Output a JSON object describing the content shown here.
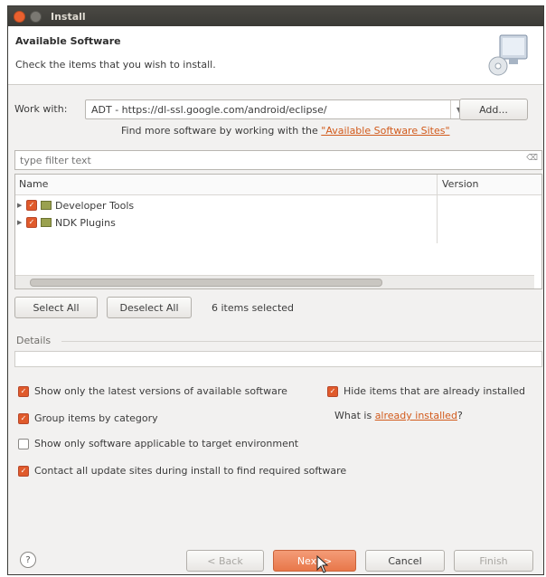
{
  "window": {
    "title": "Install"
  },
  "header": {
    "title": "Available Software",
    "description": "Check the items that you wish to install."
  },
  "work_with": {
    "label": "Work with:",
    "value": "ADT - https://dl-ssl.google.com/android/eclipse/",
    "add_button": "Add..."
  },
  "find_more": {
    "text": "Find more software by working with the ",
    "link": "\"Available Software Sites\""
  },
  "filter": {
    "placeholder": "type filter text"
  },
  "tree": {
    "columns": [
      "Name",
      "Version"
    ],
    "items": [
      {
        "label": "Developer Tools",
        "checked": true
      },
      {
        "label": "NDK Plugins",
        "checked": true
      }
    ]
  },
  "selection": {
    "select_all": "Select All",
    "deselect_all": "Deselect All",
    "count_text": "6 items selected"
  },
  "details": {
    "label": "Details"
  },
  "options": {
    "latest_versions": {
      "label": "Show only the latest versions of available software",
      "checked": true
    },
    "hide_installed": {
      "label": "Hide items that are already installed",
      "checked": true
    },
    "group_by_category": {
      "label": "Group items by category",
      "checked": true
    },
    "what_is_prefix": "What is ",
    "what_is_link": "already installed",
    "what_is_suffix": "?",
    "target_env": {
      "label": "Show only software applicable to target environment",
      "checked": false
    },
    "contact_sites": {
      "label": "Contact all update sites during install to find required software",
      "checked": true
    }
  },
  "footer": {
    "help": "?",
    "back": "< Back",
    "next": "Next >",
    "cancel": "Cancel",
    "finish": "Finish"
  },
  "colors": {
    "accent": "#e05a2b",
    "link": "#d25b1c",
    "titlebar": "#3b3a36"
  }
}
